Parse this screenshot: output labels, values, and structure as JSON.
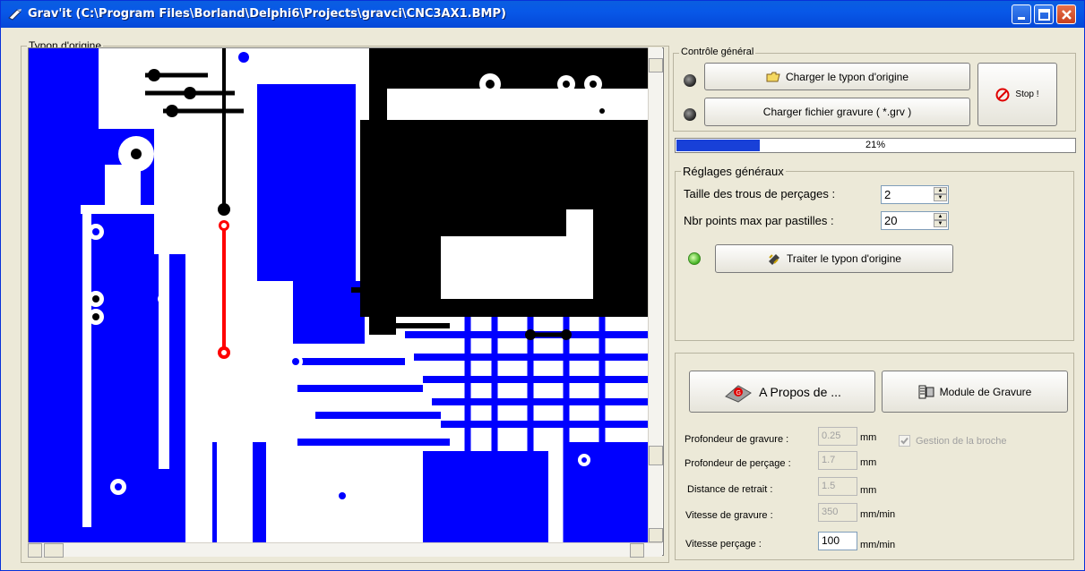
{
  "window": {
    "title": "Grav'it (C:\\Program Files\\Borland\\Delphi6\\Projects\\gravci\\CNC3AX1.BMP)"
  },
  "typon": {
    "group_label": "Typon d'origine"
  },
  "controle": {
    "group_label": "Contrôle général",
    "charger_typon_label": "Charger le typon d'origine",
    "charger_gravure_label": "Charger fichier gravure ( *.grv )",
    "stop_label": "Stop !",
    "progress_value": 0.21,
    "progress_text": "21%"
  },
  "reglages": {
    "group_label": "Réglages généraux",
    "taille_label": "Taille des trous de perçages :",
    "taille_value": "2",
    "nbr_label": "Nbr points max par pastilles :",
    "nbr_value": "20",
    "traiter_label": "Traiter le typon d'origine"
  },
  "module": {
    "apropos_label": "A Propos de ...",
    "module_label": "Module de Gravure",
    "prof_gravure_label": "Profondeur de gravure :",
    "prof_gravure_value": "0.25",
    "prof_percage_label": "Profondeur de perçage :",
    "prof_percage_value": "1.7",
    "distance_label": "Distance de retrait :",
    "distance_value": "1.5",
    "vit_gravure_label": "Vitesse de gravure :",
    "vit_gravure_value": "350",
    "vit_percage_label": "Vitesse perçage :",
    "vit_percage_value": "100",
    "unit_mm": "mm",
    "unit_mmmin": "mm/min",
    "gestion_label": "Gestion de la broche"
  },
  "colors": {
    "copper_blue": "#0000ff",
    "copper_black": "#000000",
    "trace_red": "#ff0000",
    "titlebar": "#0858e8"
  }
}
